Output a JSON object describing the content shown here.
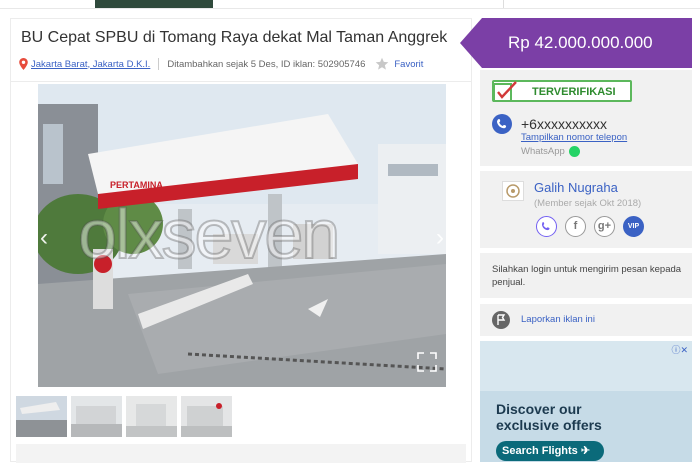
{
  "listing": {
    "title": "BU Cepat SPBU di Tomang Raya dekat Mal Taman Anggrek",
    "location": "Jakarta Barat, Jakarta D.K.I.",
    "added": "Ditambahkan sejak 5 Des, ID iklan: 502905746",
    "favorite_label": "Favorit",
    "watermark": "olxseven",
    "station_brand": "PERTAMINA",
    "price": "Rp 42.000.000.000",
    "thumbnail_count": 4
  },
  "contact": {
    "verified_label": "TERVERIFIKASI",
    "phone": "+6xxxxxxxxxx",
    "show_phone_label": "Tampilkan nomor telepon",
    "whatsapp_label": "WhatsApp"
  },
  "seller": {
    "name": "Galih Nugraha",
    "member_since": "(Member sejak Okt 2018)",
    "social_icons": [
      "viber-icon",
      "facebook-icon",
      "google-plus-icon",
      "vip-badge"
    ],
    "vip_label": "VIP",
    "facebook_glyph": "f",
    "google_glyph": "g+"
  },
  "login_note": "Silahkan login untuk mengirim pesan kepada penjual.",
  "report_label": "Laporkan iklan ini",
  "ad": {
    "headline": "Discover our exclusive offers",
    "button_label": "Search Flights",
    "close_label": "ⓘ✕"
  },
  "colors": {
    "price_tag": "#7b3fa6",
    "link": "#3b62c4",
    "verified": "#5cb85c"
  }
}
